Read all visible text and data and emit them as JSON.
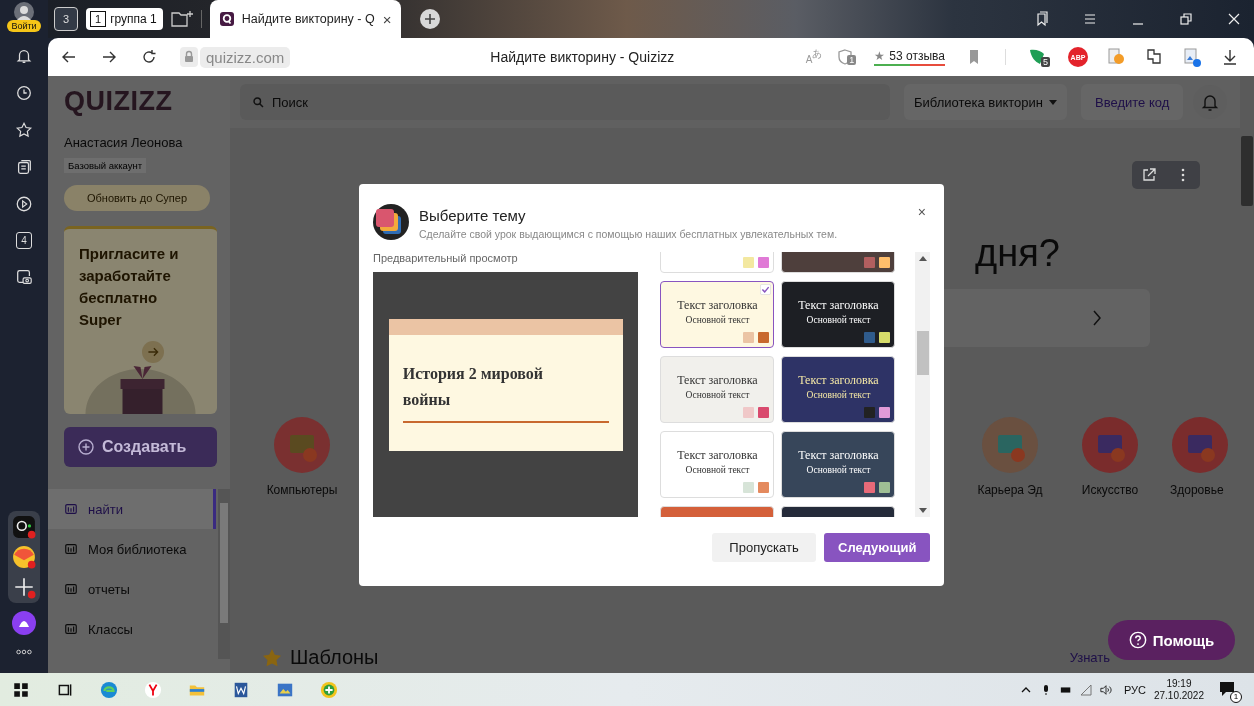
{
  "browser": {
    "login": "Войти",
    "group_count": "3",
    "group": {
      "number": "1",
      "label": "группа 1"
    },
    "tab": {
      "title": "Найдите викторину - Q",
      "close": "×"
    },
    "address": "quizizz.com",
    "page_title": "Найдите викторину - Quizizz",
    "translate": {
      "latin": "A",
      "kana": "あ"
    },
    "shield_count": "1",
    "reviews": {
      "star": "★",
      "text": "53 отзыва"
    },
    "ext_count": "5",
    "adblock": "ABP"
  },
  "rail": {
    "tabs_count": "4"
  },
  "sidebar": {
    "logo": "QUIZIZZ",
    "user": "Анастасия Леонова",
    "plan": "Базовый аккаунт",
    "upgrade": "Обновить до Супер",
    "promo": "Пригласите и заработайте бесплатно Super",
    "create": "Создавать",
    "nav": [
      {
        "label": "найти",
        "selected": true
      },
      {
        "label": "Моя библиотека",
        "selected": false
      },
      {
        "label": "отчеты",
        "selected": false
      },
      {
        "label": "Классы",
        "selected": false
      }
    ]
  },
  "header": {
    "search_placeholder": "Поиск",
    "library": "Библиотека викторин",
    "code": "Введите код"
  },
  "main": {
    "heading": "дня?",
    "categories": [
      "Компьютеры",
      "Карьера Эд",
      "Искусство",
      "Здоровье"
    ],
    "templates": "Шаблоны",
    "learn_more": "Узнать",
    "help": "Помощь"
  },
  "modal": {
    "title": "Выберите тему",
    "subtitle": "Сделайте свой урок выдающимся с помощью наших бесплатных увлекательных тем.",
    "close": "×",
    "preview_label": "Предварительный просмотр",
    "slide_title": "История 2 мировой войны",
    "themes": [
      {
        "kind": "light",
        "color": "#ffffff",
        "swatches": [
          {
            "color": "#f3e8a0"
          },
          {
            "color": "#e07ad6"
          }
        ],
        "selected": false
      },
      {
        "kind": "dark",
        "color": "#4e3f3c",
        "swatches": [
          {
            "color": "#b25f5f"
          },
          {
            "color": "#ffbe6b"
          }
        ],
        "selected": false
      },
      {
        "kind": "light",
        "color": "#fef8e1",
        "title": "Текст заголовка",
        "body": "Основной текст",
        "swatches": [
          {
            "color": "#ebc4a4"
          },
          {
            "color": "#c8692e"
          }
        ],
        "selected": true
      },
      {
        "kind": "dark",
        "color": "#1d1f24",
        "title": "Текст заголовка",
        "body": "Основной текст",
        "swatches": [
          {
            "color": "#2f5b8c"
          },
          {
            "color": "#d6dc6a"
          }
        ],
        "selected": false
      },
      {
        "kind": "light",
        "color": "#f1f0ec",
        "title": "Текст заголовка",
        "body": "Основной текст",
        "swatches": [
          {
            "color": "#f0c8c8"
          },
          {
            "color": "#d94a6e"
          }
        ],
        "selected": false
      },
      {
        "kind": "gold",
        "color": "#2e3366",
        "title": "Текст заголовка",
        "body": "Основной текст",
        "swatches": [
          {
            "color": "#222222"
          },
          {
            "color": "#e19ad8"
          }
        ],
        "selected": false
      },
      {
        "kind": "light",
        "color": "#ffffff",
        "title": "Текст заголовка",
        "body": "Основной текст",
        "swatches": [
          {
            "color": "#d7e4d8"
          },
          {
            "color": "#e48a5e"
          }
        ],
        "selected": false
      },
      {
        "kind": "dark",
        "color": "#37465a",
        "title": "Текст заголовка",
        "body": "Основной текст",
        "swatches": [
          {
            "color": "#e86a78"
          },
          {
            "color": "#9fbf94"
          }
        ],
        "selected": false
      },
      {
        "kind": "dark",
        "color": "#d4603a",
        "selected": false
      },
      {
        "kind": "dark",
        "color": "#252b3a",
        "selected": false
      }
    ],
    "skip": "Пропускать",
    "next": "Следующий"
  },
  "taskbar": {
    "language": "РУС",
    "time": "19:19",
    "date": "27.10.2022",
    "notifications": "1"
  }
}
